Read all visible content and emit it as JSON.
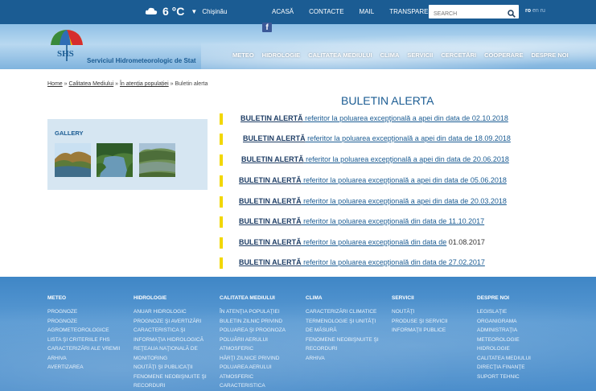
{
  "topbar": {
    "temperature": "6 °C",
    "city": "Chişinău",
    "nav": [
      "ACASĂ",
      "CONTACTE",
      "MAIL",
      "TRANSPARENŢA"
    ],
    "search_placeholder": "SEARCH",
    "lang_active": "ro",
    "lang_en": "en",
    "lang_ru": "ru"
  },
  "header": {
    "site_name": "Serviciul Hidrometeorologic de Stat",
    "logo_text": "SHS",
    "facebook": "f",
    "nav": [
      "METEO",
      "HIDROLOGIE",
      "CALITATEA MEDIULUI",
      "CLIMA",
      "SERVICII",
      "CERCETĂRI",
      "COOPERARE",
      "DESPRE NOI"
    ]
  },
  "breadcrumb": {
    "home": "Home",
    "sep": "»",
    "crumb1": "Calitatea Mediului",
    "crumb2": "În atenția populației",
    "current": "Buletin alerta"
  },
  "gallery": {
    "title": "GALLERY"
  },
  "main": {
    "title": "BULETIN ALERTA",
    "bulletins": [
      {
        "bold": "BULETIN ALERTĂ",
        "rest": " referitor la poluarea excepţională a apei din data de 02.10.2018",
        "extra": ""
      },
      {
        "bold": "BULETIN ALERTĂ",
        "rest": " referitor la poluarea excepţională a apei din data de 18.09.2018",
        "extra": ""
      },
      {
        "bold": "BULETIN ALERTĂ",
        "rest": " referitor la poluarea excepţională a apei din data de 20.06.2018",
        "extra": ""
      },
      {
        "bold": "BULETIN ALERTĂ",
        "rest": " referitor la poluarea excepţională a apei din data de 05.06.2018",
        "extra": ""
      },
      {
        "bold": "BULETIN ALERTĂ",
        "rest": " referitor la poluarea excepţională a apei din data de 20.03.2018",
        "extra": ""
      },
      {
        "bold": "BULETIN  ALERTĂ",
        "rest": " referitor la poluarea excepţională din data de 11.10.2017",
        "extra": ""
      },
      {
        "bold": "BULETIN ALERTĂ",
        "rest": " referitor la poluarea excepţională din data de",
        "extra": " 01.08.2017"
      },
      {
        "bold": "BULETIN ALERTĂ",
        "rest": " referitor la poluarea excepţională din data de 27.02.2017",
        "extra": ""
      }
    ]
  },
  "footer": {
    "columns": [
      {
        "heading": "METEO",
        "items": [
          "PROGNOZE",
          "PROGNOZE",
          "AGROMETEOROLOGICE",
          "LISTA ŞI CRITERIILE FHS",
          "CARACTERIZĂRI ALE VREMII",
          "ARHIVA",
          "AVERTIZAREA"
        ]
      },
      {
        "heading": "HIDROLOGIE",
        "items": [
          "ANUAR HIDROLOGIC",
          "PROGNOZE ŞI AVERTIZĂRI",
          "CARACTERISTICA ŞI",
          "INFORMAŢIA HIDROLOGICĂ",
          "REŢEAUA NAŢIONALĂ DE",
          "MONITORING",
          "NOUTĂŢI ŞI PUBLICAŢII",
          "FENOMENE NEOBIŞNUITE ŞI",
          "RECORDURI"
        ]
      },
      {
        "heading": "CALITATEA MEDIULUI",
        "items": [
          "ÎN ATENŢIA POPULAŢIEI",
          "BULETIN ZILNIC PRIVIND",
          "POLUAREA ŞI PROGNOZA",
          "POLUĂRII AERULUI",
          "ATMOSFERIC",
          "HĂRŢI ZILNICE PRIVIND",
          "POLUAREA AERULUI",
          "ATMOSFERIC",
          "CARACTERISTICA"
        ]
      },
      {
        "heading": "CLIMA",
        "items": [
          "CARACTERIZĂRI CLIMATICE",
          "TERMENOLOGIE ŞI UNITĂŢI",
          "DE MĂSURĂ",
          "FENOMENE NEOBIŞNUITE ŞI",
          "RECORDURI",
          "ARHIVA"
        ]
      },
      {
        "heading": "SERVICII",
        "items": [
          "NOUTĂŢI",
          "PRODUSE ŞI SERVICII",
          "INFORMAŢII PUBLICE"
        ]
      },
      {
        "heading": "DESPRE NOI",
        "items": [
          "LEGISLAŢIE",
          "ORGANIGRAMA",
          "ADMINISTRAŢIA",
          "METEOROLOGIE",
          "HIDROLOGIE",
          "CALITATEA MEDIULUI",
          "DIRECŢIA FINANŢE",
          "SUPORT TEHNIC"
        ]
      }
    ]
  },
  "colors": {
    "topbar": "#1b5c93",
    "accent_bar": "#f2d700",
    "title": "#1b5c93",
    "footer": "#4a8dcb"
  }
}
